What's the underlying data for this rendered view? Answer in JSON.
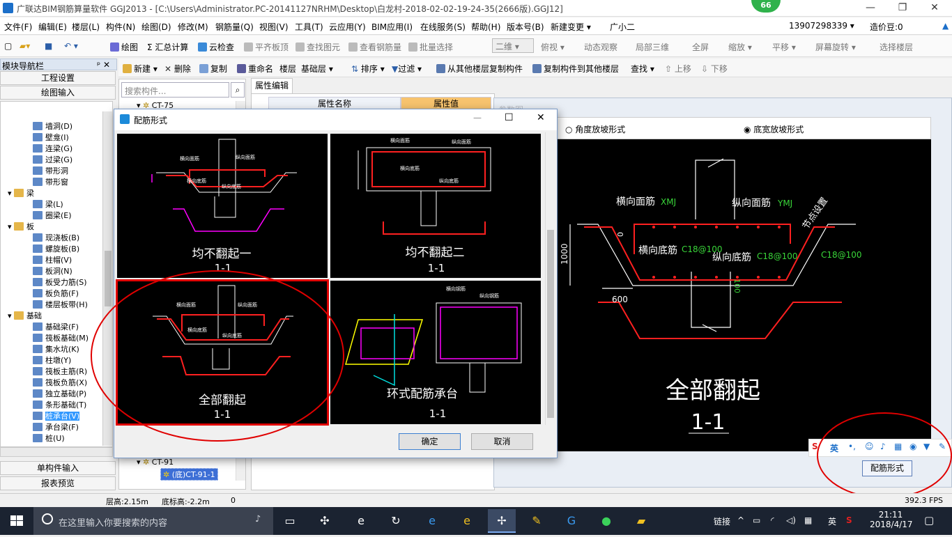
{
  "window": {
    "title": "广联达BIM钢筋算量软件 GGJ2013 - [C:\\Users\\Administrator.PC-20141127NRHM\\Desktop\\白龙村-2018-02-02-19-24-35(2666版).GGJ12]",
    "badge": "66",
    "minimize": "—",
    "restore": "❐",
    "close": "✕"
  },
  "menu": [
    "文件(F)",
    "编辑(E)",
    "楼层(L)",
    "构件(N)",
    "绘图(D)",
    "修改(M)",
    "钢筋量(Q)",
    "视图(V)",
    "工具(T)",
    "云应用(Y)",
    "BIM应用(I)",
    "在线服务(S)",
    "帮助(H)",
    "版本号(B)",
    "新建变更 ▾",
    "广小二"
  ],
  "account": {
    "phone": "13907298339 ▾",
    "beans": "造价豆:0"
  },
  "toolbar1": [
    "绘图",
    "Σ 汇总计算",
    "云检查",
    "平齐板顶",
    "查找图元",
    "查看钢筋量",
    "批量选择",
    "二维",
    "俯视 ▾",
    "动态观察",
    "局部三维",
    "全屏",
    "缩放 ▾",
    "平移 ▾",
    "屏幕旋转 ▾",
    "选择楼层"
  ],
  "toolbar2": [
    "新建 ▾",
    "删除",
    "复制",
    "重命名",
    "楼层",
    "基础层",
    "排序 ▾",
    "过滤 ▾",
    "从其他楼层复制构件",
    "复制构件到其他楼层",
    "查找 ▾",
    "上移",
    "下移"
  ],
  "nav": {
    "header": "模块导航栏",
    "pin": "ᵖ ✕",
    "project_settings": "工程设置",
    "drawing_input": "绘图输入",
    "single_input": "单构件输入",
    "report_preview": "报表预览",
    "tree": [
      {
        "label": "墙洞(D)",
        "level": 2
      },
      {
        "label": "壁龛(I)",
        "level": 2
      },
      {
        "label": "连梁(G)",
        "level": 2
      },
      {
        "label": "过梁(G)",
        "level": 2
      },
      {
        "label": "带形洞",
        "level": 2
      },
      {
        "label": "带形窗",
        "level": 2
      },
      {
        "label": "梁",
        "level": 1
      },
      {
        "label": "梁(L)",
        "level": 2
      },
      {
        "label": "圈梁(E)",
        "level": 2
      },
      {
        "label": "板",
        "level": 1
      },
      {
        "label": "现浇板(B)",
        "level": 2
      },
      {
        "label": "螺旋板(B)",
        "level": 2
      },
      {
        "label": "柱帽(V)",
        "level": 2
      },
      {
        "label": "板洞(N)",
        "level": 2
      },
      {
        "label": "板受力筋(S)",
        "level": 2
      },
      {
        "label": "板负筋(F)",
        "level": 2
      },
      {
        "label": "楼层板带(H)",
        "level": 2
      },
      {
        "label": "基础",
        "level": 1
      },
      {
        "label": "基础梁(F)",
        "level": 2
      },
      {
        "label": "筏板基础(M)",
        "level": 2
      },
      {
        "label": "集水坑(K)",
        "level": 2
      },
      {
        "label": "柱墩(Y)",
        "level": 2
      },
      {
        "label": "筏板主筋(R)",
        "level": 2
      },
      {
        "label": "筏板负筋(X)",
        "level": 2
      },
      {
        "label": "独立基础(P)",
        "level": 2
      },
      {
        "label": "条形基础(T)",
        "level": 2
      },
      {
        "label": "桩承台(V)",
        "level": 2,
        "selected": true
      },
      {
        "label": "承台梁(F)",
        "level": 2
      },
      {
        "label": "桩(U)",
        "level": 2
      }
    ]
  },
  "components": {
    "search_placeholder": "搜索构件...",
    "top_item": "CT-75",
    "bottom_parent": "CT-91",
    "bottom_child": "(底)CT-91-1"
  },
  "properties": {
    "tab": "属性编辑",
    "col_name": "属性名称",
    "col_value": "属性值"
  },
  "right": {
    "faded_title": "参数图",
    "option_angle": "角度放坡形式",
    "option_width": "底宽放坡形式",
    "big_title": "全部翻起",
    "big_section": "1-1",
    "labels": {
      "xmj": "横向面筋",
      "xmj_code": "XMJ",
      "ymj": "纵向面筋",
      "ymj_code": "YMJ",
      "xdj": "横向底筋",
      "xdj_val": "C18@100",
      "ydj": "纵向底筋",
      "ydj_val": "C18@100",
      "side_val": "C18@100",
      "node": "节点设置",
      "dim_1000": "1000",
      "dim_600": "600",
      "dim_100": "100",
      "dim_0": "0"
    },
    "button": "配筋形式"
  },
  "dialog": {
    "title": "配筋形式",
    "cells": [
      {
        "title": "均不翻起一",
        "section": "1-1"
      },
      {
        "title": "均不翻起二",
        "section": "1-1"
      },
      {
        "title": "全部翻起",
        "section": "1-1"
      },
      {
        "title": "环式配筋承台",
        "section": "1-1"
      }
    ],
    "small_labels": {
      "a": "横向面筋",
      "b": "纵向面筋",
      "c": "横向底筋",
      "d": "纵向底筋",
      "e": "横向钢筋",
      "f": "纵向钢筋"
    },
    "ok": "确定",
    "cancel": "取消"
  },
  "status": {
    "floor_height": "层高:2.15m",
    "bottom_height": "底标高:-2.2m",
    "value": "0",
    "fps": "392.3 FPS"
  },
  "ime": {
    "lang": "英"
  },
  "taskbar": {
    "search_placeholder": "在这里输入你要搜索的内容",
    "link": "链接",
    "ime": "英",
    "time": "21:11",
    "date": "2018/4/17"
  },
  "colors": {
    "dialog_border": "#7a9bc9",
    "highlight_red": "#e00000",
    "canvas_bg": "#000000",
    "rebar_red": "#ff2020",
    "label_green": "#39d639",
    "magenta": "#ff00ff"
  }
}
